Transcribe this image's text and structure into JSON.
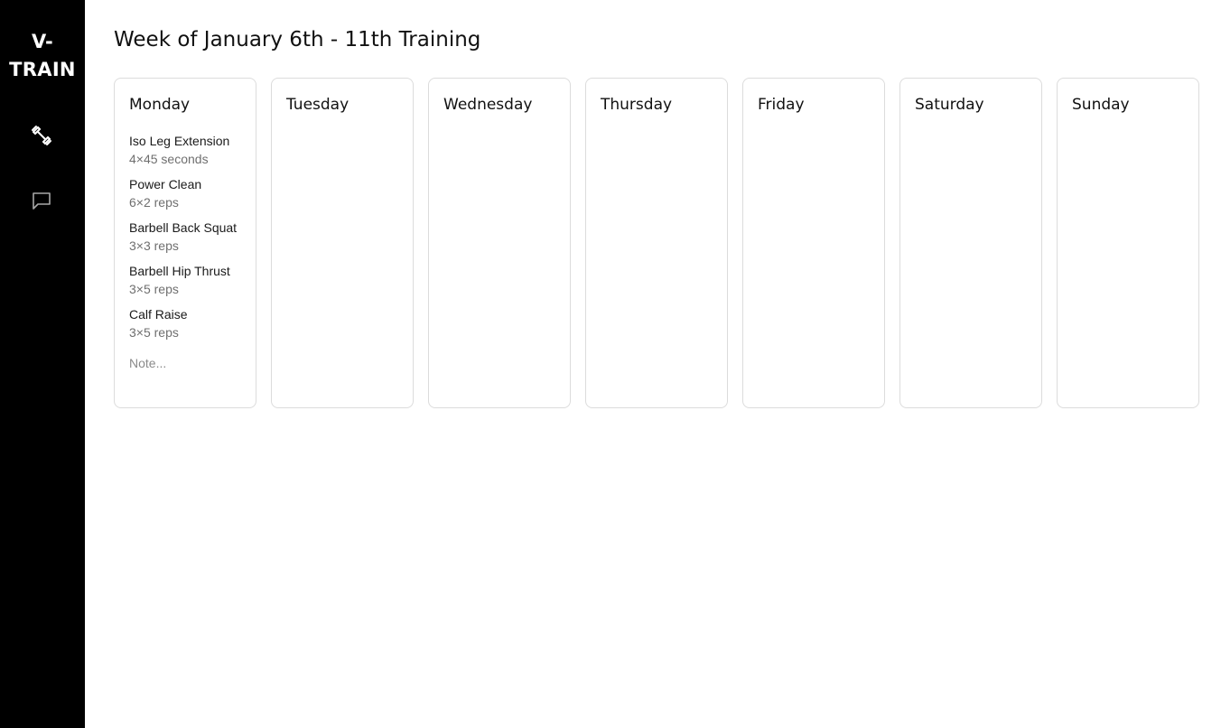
{
  "app": {
    "logo_line1": "V-",
    "logo_line2": "TRAIN"
  },
  "sidebar": {
    "items": [
      {
        "icon": "dumbbell-icon",
        "active": true
      },
      {
        "icon": "chat-icon",
        "active": false
      }
    ]
  },
  "page": {
    "title": "Week of January 6th - 11th Training"
  },
  "days": [
    {
      "name": "Monday",
      "exercises": [
        {
          "name": "Iso Leg Extension",
          "detail": "4×45 seconds"
        },
        {
          "name": "Power Clean",
          "detail": "6×2 reps"
        },
        {
          "name": "Barbell Back Squat",
          "detail": "3×3 reps"
        },
        {
          "name": "Barbell Hip Thrust",
          "detail": "3×5 reps"
        },
        {
          "name": "Calf Raise",
          "detail": "3×5 reps"
        }
      ],
      "note_placeholder": "Note..."
    },
    {
      "name": "Tuesday",
      "exercises": []
    },
    {
      "name": "Wednesday",
      "exercises": []
    },
    {
      "name": "Thursday",
      "exercises": []
    },
    {
      "name": "Friday",
      "exercises": []
    },
    {
      "name": "Saturday",
      "exercises": []
    },
    {
      "name": "Sunday",
      "exercises": []
    }
  ],
  "colors": {
    "sidebar_bg": "#000000",
    "card_border": "#dcdcdc",
    "muted_text": "#6f6f6f"
  }
}
